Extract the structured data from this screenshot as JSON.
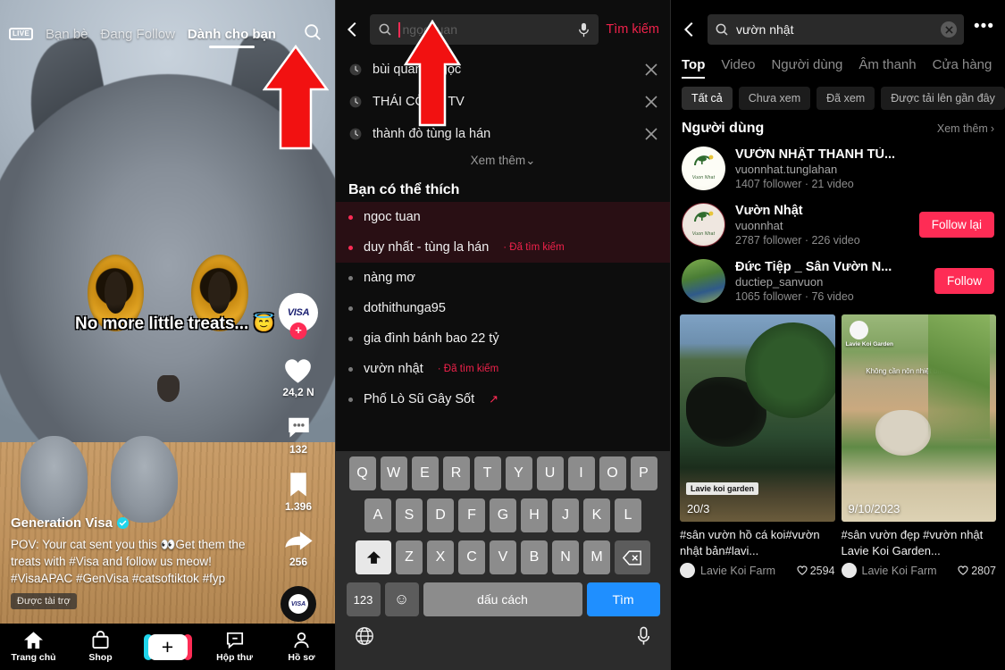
{
  "feed": {
    "live_label": "LIVE",
    "tabs": [
      {
        "label": "Bạn bè",
        "active": false
      },
      {
        "label": "Đang Follow",
        "active": false
      },
      {
        "label": "Dành cho bạn",
        "active": true
      }
    ],
    "search_icon": "search-icon",
    "overlay_text": "No more little treats... 😇",
    "brand_avatar_text": "VISA",
    "actions": {
      "like_count": "24,2 N",
      "comment_count": "132",
      "bookmark_count": "1.396",
      "share_count": "256"
    },
    "author_name": "Generation Visa",
    "caption": "POV: Your cat sent you this 👀Get them the treats with #Visa and follow us meow! #VisaAPAC #GenVisa #catsoftiktok #fyp",
    "sponsored_label": "Được tài trợ",
    "bottom_nav": [
      {
        "label": "Trang chủ",
        "icon": "home-icon"
      },
      {
        "label": "Shop",
        "icon": "shop-bag-icon"
      },
      {
        "label": "",
        "icon": "create-plus-icon"
      },
      {
        "label": "Hộp thư",
        "icon": "inbox-icon"
      },
      {
        "label": "Hồ sơ",
        "icon": "profile-icon"
      }
    ]
  },
  "search": {
    "placeholder": "ngọc tuan",
    "mic_icon": "microphone-icon",
    "submit_label": "Tìm kiếm",
    "history": [
      "bùi quang ngọc",
      "THÁI CÔNG TV",
      "thành đò tùng la hán"
    ],
    "show_more_label": "Xem thêm",
    "suggest_title": "Bạn có thể thích",
    "suggestions": [
      {
        "text": "ngoc tuan",
        "tag": "",
        "hot": true,
        "trending": false
      },
      {
        "text": "duy nhất - tùng la hán",
        "tag": "· Đã tìm kiếm",
        "hot": true,
        "trending": false
      },
      {
        "text": "nàng mơ",
        "tag": "",
        "hot": false,
        "trending": false
      },
      {
        "text": "dothithunga95",
        "tag": "",
        "hot": false,
        "trending": false
      },
      {
        "text": "gia đình bánh bao 22 tỷ",
        "tag": "",
        "hot": false,
        "trending": false
      },
      {
        "text": "vườn nhật",
        "tag": "· Đã tìm kiếm",
        "hot": false,
        "trending": false
      },
      {
        "text": "Phố Lò Sũ Gây Sốt",
        "tag": "",
        "hot": false,
        "trending": true
      }
    ],
    "keyboard": {
      "row1": [
        "Q",
        "W",
        "E",
        "R",
        "T",
        "Y",
        "U",
        "I",
        "O",
        "P"
      ],
      "row2": [
        "A",
        "S",
        "D",
        "F",
        "G",
        "H",
        "J",
        "K",
        "L"
      ],
      "row3": [
        "Z",
        "X",
        "C",
        "V",
        "B",
        "N",
        "M"
      ],
      "shift_label": "shift-key",
      "delete_label": "backspace-key",
      "num_label": "123",
      "emoji_label": "☺",
      "space_label": "dấu cách",
      "enter_label": "Tìm",
      "globe_label": "globe-icon",
      "mic_label": "microphone-icon"
    }
  },
  "results": {
    "query": "vườn nhật",
    "clear_icon": "clear-icon",
    "more_icon": "more-options-icon",
    "tabs": [
      {
        "label": "Top",
        "active": true
      },
      {
        "label": "Video",
        "active": false
      },
      {
        "label": "Người dùng",
        "active": false
      },
      {
        "label": "Âm thanh",
        "active": false
      },
      {
        "label": "Cửa hàng",
        "active": false
      }
    ],
    "filter_chips": [
      {
        "label": "Tất cả",
        "active": true
      },
      {
        "label": "Chưa xem",
        "active": false
      },
      {
        "label": "Đã xem",
        "active": false
      },
      {
        "label": "Được tải lên gần đây",
        "active": false
      }
    ],
    "users_section_title": "Người dùng",
    "users_see_more": "Xem thêm",
    "users": [
      {
        "name": "VƯỜN NHẬT THANH TÙ...",
        "handle": "vuonnhat.tunglahan",
        "meta": "1407 follower · 21 video",
        "button": ""
      },
      {
        "name": "Vườn Nhật",
        "handle": "vuonnhat",
        "meta": "2787 follower · 226 video",
        "button": "Follow lại"
      },
      {
        "name": "Đức Tiệp _ Sân Vườn N...",
        "handle": "ductiep_sanvuon",
        "meta": "1065 follower · 76 video",
        "button": "Follow"
      }
    ],
    "videos": [
      {
        "badge": "Lavie koi garden",
        "date": "20/3",
        "overlay_name": "",
        "overlay_text": "",
        "caption": "#sân vườn hồ cá koi#vườn nhật bản#lavi...",
        "author": "Lavie Koi Farm",
        "likes": "2594"
      },
      {
        "badge": "",
        "date": "9/10/2023",
        "overlay_name": "Lavie Koi Garden",
        "overlay_text": "Không cần nôn nhiệt bình an tò đủ...",
        "caption": "#sân vườn đẹp #vườn nhật Lavie Koi Garden...",
        "author": "Lavie Koi Farm",
        "likes": "2807"
      }
    ]
  }
}
